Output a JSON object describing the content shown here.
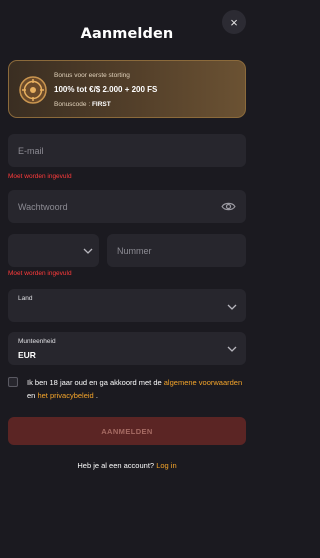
{
  "modal": {
    "title": "Aanmelden",
    "close_symbol": "×"
  },
  "bonus": {
    "label": "Bonus voor eerste storting",
    "offer": "100% tot €/$ 2.000 + 200 FS",
    "code_label": "Bonuscode :",
    "code": "FIRST",
    "icon": "coin-wheel-icon"
  },
  "form": {
    "email": {
      "placeholder": "E-mail",
      "error": "Moet worden ingevuld"
    },
    "password": {
      "placeholder": "Wachtwoord",
      "icon": "eye-icon"
    },
    "phone": {
      "code_value": "",
      "placeholder": "Nummer",
      "error": "Moet worden ingevuld"
    },
    "country": {
      "label": "Land",
      "value": ""
    },
    "currency": {
      "label": "Munteenheid",
      "value": "EUR"
    },
    "terms": {
      "text_before": "Ik ben 18 jaar oud en ga akkoord met de ",
      "link_terms": "algemene voorwaarden",
      "text_mid": " en ",
      "link_privacy": "het privacybeleid",
      "text_after": " .",
      "checked": false
    },
    "submit_label": "AANMELDEN"
  },
  "footer": {
    "question": "Heb je al een account?",
    "login_link": "Log in"
  },
  "colors": {
    "background": "#1b1a20",
    "field": "#27262d",
    "error": "#ff3b3b",
    "link": "#f5a52a",
    "submit_disabled": "#5b2524"
  }
}
